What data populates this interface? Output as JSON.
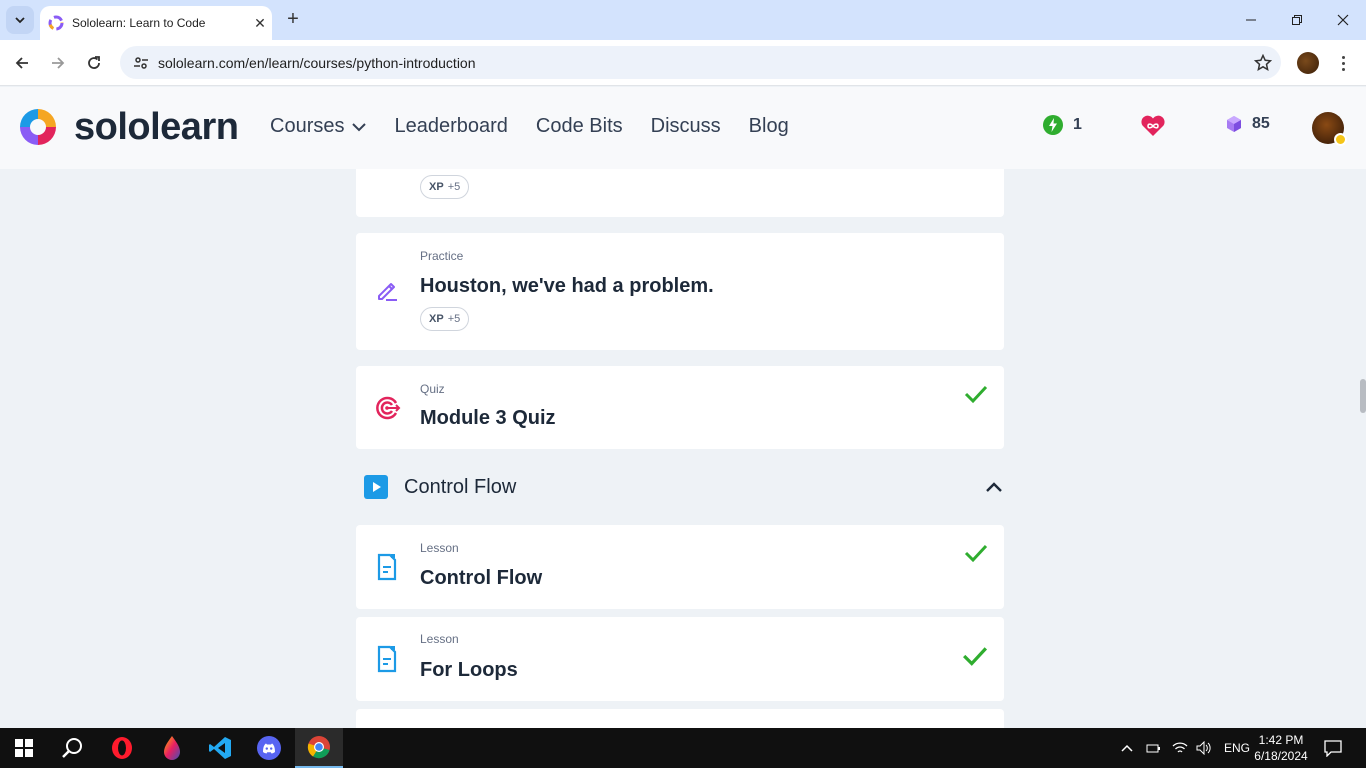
{
  "browser": {
    "tab_title": "Sololearn: Learn to Code",
    "url": "sololearn.com/en/learn/courses/python-introduction"
  },
  "site": {
    "logo_text": "sololearn",
    "nav": [
      "Courses",
      "Leaderboard",
      "Code Bits",
      "Discuss",
      "Blog"
    ],
    "streak": "1",
    "hearts_icon": "infinity-heart-icon",
    "gems": "85"
  },
  "cards": [
    {
      "type": "",
      "title": "",
      "xp_label": "XP",
      "xp_value": "+5"
    },
    {
      "type": "Practice",
      "title": "Houston, we've had a problem.",
      "xp_label": "XP",
      "xp_value": "+5",
      "icon": "pencil-icon"
    },
    {
      "type": "Quiz",
      "title": "Module 3 Quiz",
      "icon": "target-icon",
      "completed": true
    }
  ],
  "section": {
    "title": "Control Flow",
    "expanded": true
  },
  "lessons": [
    {
      "type": "Lesson",
      "title": "Control Flow",
      "completed": true
    },
    {
      "type": "Lesson",
      "title": "For Loops",
      "completed": true
    }
  ],
  "taskbar": {
    "apps": [
      "start-icon",
      "search-icon",
      "opera-icon",
      "paint-drop-icon",
      "vscode-icon",
      "discord-icon",
      "chrome-icon"
    ],
    "lang": "ENG",
    "time": "1:42 PM",
    "date": "6/18/2024"
  },
  "colors": {
    "accent_green": "#2fad2f",
    "practice_purple": "#8a5cf5",
    "quiz_pink": "#e2245c",
    "lesson_blue": "#1c9ae6"
  }
}
